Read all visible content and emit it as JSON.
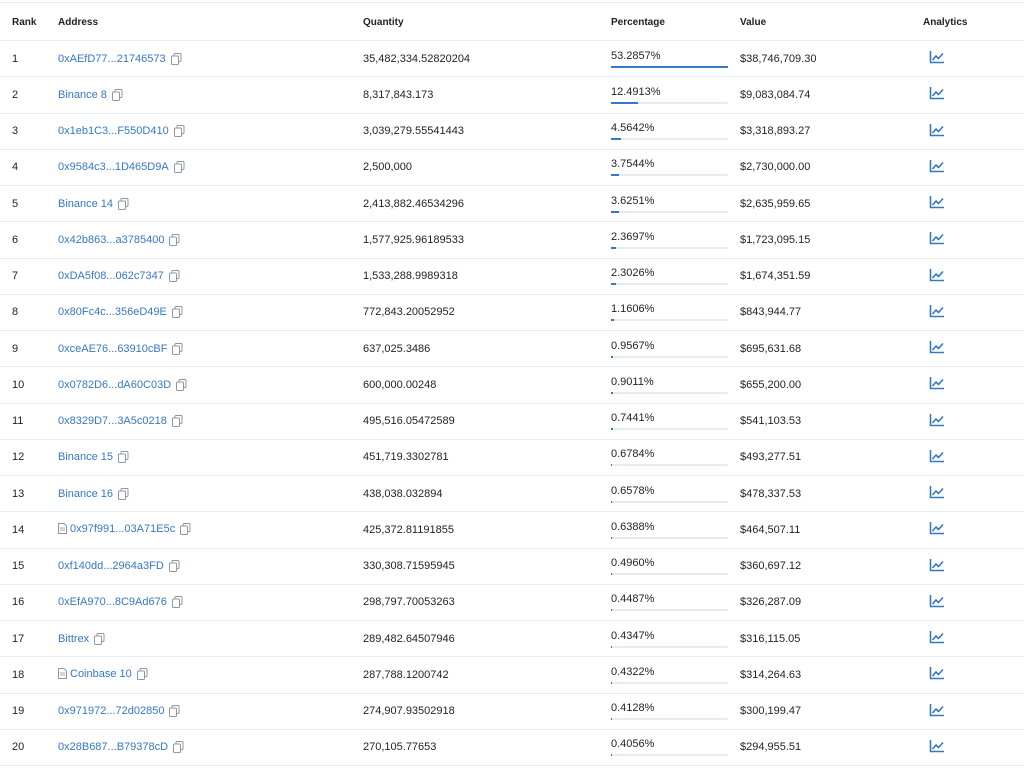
{
  "table": {
    "headers": {
      "rank": "Rank",
      "address": "Address",
      "quantity": "Quantity",
      "percentage": "Percentage",
      "value": "Value",
      "analytics": "Analytics"
    },
    "rows": [
      {
        "rank": "1",
        "address": "0xAEfD77...21746573",
        "file_icon": false,
        "quantity": "35,482,334.52820204",
        "percentage": "53.2857%",
        "pct_fraction": 1.0,
        "value": "$38,746,709.30"
      },
      {
        "rank": "2",
        "address": "Binance 8",
        "file_icon": false,
        "quantity": "8,317,843.173",
        "percentage": "12.4913%",
        "pct_fraction": 0.2344,
        "value": "$9,083,084.74"
      },
      {
        "rank": "3",
        "address": "0x1eb1C3...F550D410",
        "file_icon": false,
        "quantity": "3,039,279.55541443",
        "percentage": "4.5642%",
        "pct_fraction": 0.0857,
        "value": "$3,318,893.27"
      },
      {
        "rank": "4",
        "address": "0x9584c3...1D465D9A",
        "file_icon": false,
        "quantity": "2,500,000",
        "percentage": "3.7544%",
        "pct_fraction": 0.0705,
        "value": "$2,730,000.00"
      },
      {
        "rank": "5",
        "address": "Binance 14",
        "file_icon": false,
        "quantity": "2,413,882.46534296",
        "percentage": "3.6251%",
        "pct_fraction": 0.068,
        "value": "$2,635,959.65"
      },
      {
        "rank": "6",
        "address": "0x42b863...a3785400",
        "file_icon": false,
        "quantity": "1,577,925.96189533",
        "percentage": "2.3697%",
        "pct_fraction": 0.0445,
        "value": "$1,723,095.15"
      },
      {
        "rank": "7",
        "address": "0xDA5f08...062c7347",
        "file_icon": false,
        "quantity": "1,533,288.9989318",
        "percentage": "2.3026%",
        "pct_fraction": 0.0432,
        "value": "$1,674,351.59"
      },
      {
        "rank": "8",
        "address": "0x80Fc4c...356eD49E",
        "file_icon": false,
        "quantity": "772,843.20052952",
        "percentage": "1.1606%",
        "pct_fraction": 0.0218,
        "value": "$843,944.77"
      },
      {
        "rank": "9",
        "address": "0xceAE76...63910cBF",
        "file_icon": false,
        "quantity": "637,025.3486",
        "percentage": "0.9567%",
        "pct_fraction": 0.018,
        "value": "$695,631.68"
      },
      {
        "rank": "10",
        "address": "0x0782D6...dA60C03D",
        "file_icon": false,
        "quantity": "600,000.00248",
        "percentage": "0.9011%",
        "pct_fraction": 0.0169,
        "value": "$655,200.00"
      },
      {
        "rank": "11",
        "address": "0x8329D7...3A5c0218",
        "file_icon": false,
        "quantity": "495,516.05472589",
        "percentage": "0.7441%",
        "pct_fraction": 0.014,
        "value": "$541,103.53"
      },
      {
        "rank": "12",
        "address": "Binance 15",
        "file_icon": false,
        "quantity": "451,719.3302781",
        "percentage": "0.6784%",
        "pct_fraction": 0.0127,
        "value": "$493,277.51"
      },
      {
        "rank": "13",
        "address": "Binance 16",
        "file_icon": false,
        "quantity": "438,038.032894",
        "percentage": "0.6578%",
        "pct_fraction": 0.0123,
        "value": "$478,337.53"
      },
      {
        "rank": "14",
        "address": "0x97f991...03A71E5c",
        "file_icon": true,
        "quantity": "425,372.81191855",
        "percentage": "0.6388%",
        "pct_fraction": 0.012,
        "value": "$464,507.11"
      },
      {
        "rank": "15",
        "address": "0xf140dd...2964a3FD",
        "file_icon": false,
        "quantity": "330,308.71595945",
        "percentage": "0.4960%",
        "pct_fraction": 0.0093,
        "value": "$360,697.12"
      },
      {
        "rank": "16",
        "address": "0xEfA970...8C9Ad676",
        "file_icon": false,
        "quantity": "298,797.70053263",
        "percentage": "0.4487%",
        "pct_fraction": 0.0084,
        "value": "$326,287.09"
      },
      {
        "rank": "17",
        "address": "Bittrex",
        "file_icon": false,
        "quantity": "289,482.64507946",
        "percentage": "0.4347%",
        "pct_fraction": 0.0082,
        "value": "$316,115.05"
      },
      {
        "rank": "18",
        "address": "Coinbase 10",
        "file_icon": true,
        "quantity": "287,788.1200742",
        "percentage": "0.4322%",
        "pct_fraction": 0.0081,
        "value": "$314,264.63"
      },
      {
        "rank": "19",
        "address": "0x971972...72d02850",
        "file_icon": false,
        "quantity": "274,907.93502918",
        "percentage": "0.4128%",
        "pct_fraction": 0.0077,
        "value": "$300,199.47"
      },
      {
        "rank": "20",
        "address": "0x28B687...B79378cD",
        "file_icon": false,
        "quantity": "270,105.77653",
        "percentage": "0.4056%",
        "pct_fraction": 0.0076,
        "value": "$294,955.51"
      }
    ]
  },
  "icons": {
    "copy": "copy-icon",
    "file": "file-icon",
    "analytics": "chart-line-icon"
  },
  "colors": {
    "link": "#3578c6",
    "bar_fill": "#3578c6",
    "bar_track": "#e7eaf3",
    "divider": "#e7eaf3"
  }
}
